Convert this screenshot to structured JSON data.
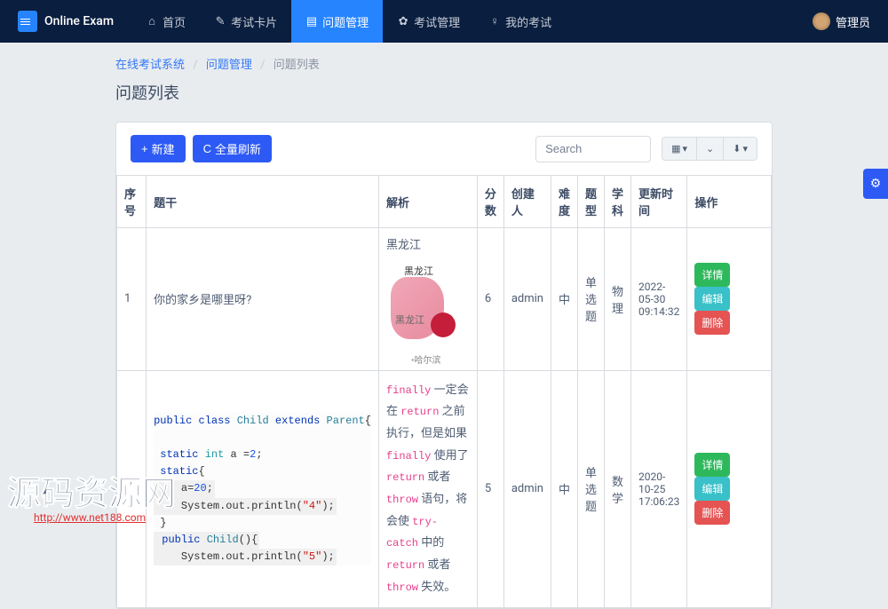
{
  "app_name": "Online Exam",
  "nav": {
    "home": "首页",
    "exam_card": "考试卡片",
    "question_mgmt": "问题管理",
    "exam_mgmt": "考试管理",
    "my_exam": "我的考试"
  },
  "user": {
    "role": "管理员"
  },
  "breadcrumb": {
    "root": "在线考试系统",
    "mid": "问题管理",
    "leaf": "问题列表"
  },
  "page_title": "问题列表",
  "toolbar": {
    "new_label": "新建",
    "refresh_label": "全量刷新",
    "search_placeholder": "Search"
  },
  "columns": {
    "seq": "序号",
    "question": "题干",
    "analysis": "解析",
    "score": "分数",
    "creator": "创建人",
    "difficulty": "难度",
    "type": "题型",
    "subject": "学科",
    "updated": "更新时间",
    "ops": "操作"
  },
  "rows": [
    {
      "seq": "1",
      "question": "你的家乡是哪里呀?",
      "analysis_title": "黑龙江",
      "map_label1": "黑龙江",
      "map_label2": "黑龙江",
      "map_label3": "•哈尔滨",
      "score": "6",
      "creator": "admin",
      "difficulty": "中",
      "type": "单选题",
      "subject": "物理",
      "updated": "2022-05-30 09:14:32"
    },
    {
      "seq": "",
      "analysis_1a": "finally",
      "analysis_1b": " 一定会在 ",
      "analysis_2a": "return",
      "analysis_2b": " 之前执行，但是如果 ",
      "analysis_3a": "finally",
      "analysis_3b": " 使用了 ",
      "analysis_4a": "return",
      "analysis_4b": " 或者 ",
      "analysis_5a": "throw",
      "analysis_5b": " 语句，将会使 ",
      "analysis_6a": "try-catch",
      "analysis_6b": " 中的 ",
      "analysis_7a": "return",
      "analysis_7b": " 或者 ",
      "analysis_8a": "throw",
      "analysis_8b": " 失效。",
      "score": "5",
      "creator": "admin",
      "difficulty": "中",
      "type": "单选题",
      "subject": "数学",
      "updated": "2020-10-25 17:06:23"
    }
  ],
  "actions": {
    "detail": "详情",
    "edit": "编辑",
    "delete": "删除"
  },
  "watermark": {
    "text": "源码资源网",
    "url": "http://www.net188.com"
  },
  "code": {
    "l1a": "public",
    "l1b": " class",
    "l1c": " Child",
    "l1d": " extends",
    "l1e": " Parent",
    "l1f": "{",
    "l2a": " static",
    "l2b": " int",
    "l2c": " a =",
    "l2d": "2",
    "l2e": ";",
    "l3a": " static",
    "l3b": "{",
    "l4a": "a=",
    "l4b": "20",
    "l4c": ";",
    "l5a": "System.out.println(",
    "l5b": "\"4\"",
    "l5c": ");",
    "l7a": "public",
    "l7b": " Child",
    "l7c": "(){",
    "l8a": "System.out.println(",
    "l8b": "\"5\"",
    "l8c": ");"
  }
}
